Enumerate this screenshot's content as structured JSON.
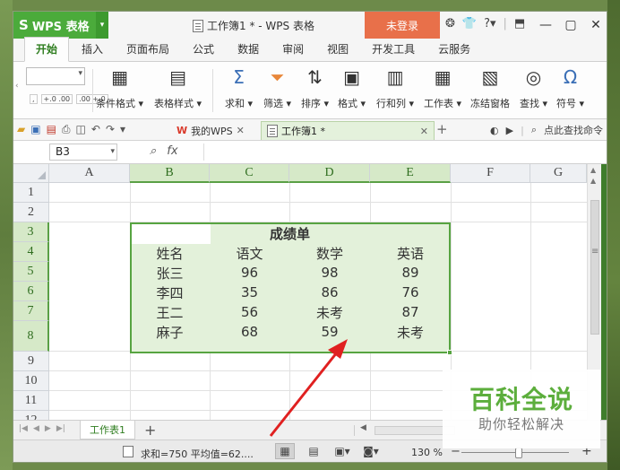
{
  "titlebar": {
    "app_name": "WPS 表格",
    "document_title": "工作簿1 * - WPS 表格",
    "login_label": "未登录",
    "help_label": "?",
    "icons": [
      "skin-icon",
      "shirt-icon",
      "help-icon",
      "restore-icon",
      "minimize-icon",
      "maximize-icon",
      "close-icon"
    ]
  },
  "menu": {
    "tabs": [
      "开始",
      "插入",
      "页面布局",
      "公式",
      "数据",
      "审阅",
      "视图",
      "开发工具",
      "云服务"
    ],
    "active_tab": "开始"
  },
  "ribbon": {
    "number_format": [
      ",",
      "+.0 .00",
      ".00 +.0"
    ],
    "buttons": [
      {
        "label": "条件格式 ▾",
        "icon": "conditional-format-icon",
        "glyph": "▦"
      },
      {
        "label": "表格样式 ▾",
        "icon": "table-style-icon",
        "glyph": "▤"
      },
      {
        "label": "求和 ▾",
        "icon": "sum-icon",
        "glyph": "Σ"
      },
      {
        "label": "筛选 ▾",
        "icon": "filter-icon",
        "glyph": "⏷"
      },
      {
        "label": "排序 ▾",
        "icon": "sort-icon",
        "glyph": "⇅"
      },
      {
        "label": "格式 ▾",
        "icon": "format-icon",
        "glyph": "▣"
      },
      {
        "label": "行和列 ▾",
        "icon": "row-column-icon",
        "glyph": "▥"
      },
      {
        "label": "工作表 ▾",
        "icon": "worksheet-icon",
        "glyph": "▦"
      },
      {
        "label": "冻结窗格",
        "icon": "freeze-pane-icon",
        "glyph": "▧"
      },
      {
        "label": "查找 ▾",
        "icon": "find-icon",
        "glyph": "◎"
      },
      {
        "label": "符号 ▾",
        "icon": "symbol-icon",
        "glyph": "Ω"
      }
    ]
  },
  "quickbar": {
    "mywps_label": "我的WPS",
    "mywps_glyph": "W",
    "document_tab": "工作簿1 *",
    "search_label": "点此查找命令"
  },
  "formula_bar": {
    "name_box": "B3",
    "fx_label": "fx",
    "formula": ""
  },
  "grid": {
    "columns": [
      "A",
      "B",
      "C",
      "D",
      "E",
      "F",
      "G"
    ],
    "rows": [
      "1",
      "2",
      "3",
      "4",
      "5",
      "6",
      "7",
      "8",
      "9",
      "10",
      "11",
      "12"
    ],
    "selected_columns": [
      "B",
      "C",
      "D",
      "E"
    ],
    "selected_rows": [
      "3",
      "4",
      "5",
      "6",
      "7",
      "8"
    ],
    "title": "成绩单",
    "header": [
      "姓名",
      "语文",
      "数学",
      "英语"
    ],
    "records": [
      [
        "张三",
        "96",
        "98",
        "89"
      ],
      [
        "李四",
        "35",
        "86",
        "76"
      ],
      [
        "王二",
        "56",
        "未考",
        "87"
      ],
      [
        "麻子",
        "68",
        "59",
        "未考"
      ]
    ]
  },
  "sheets": {
    "tabs": [
      "工作表1"
    ],
    "add_label": "+"
  },
  "status": {
    "summary": "求和=750 平均值=62....",
    "zoom": "130 %"
  },
  "watermark": {
    "main": "百科全说",
    "sub": "助你轻松解决"
  }
}
